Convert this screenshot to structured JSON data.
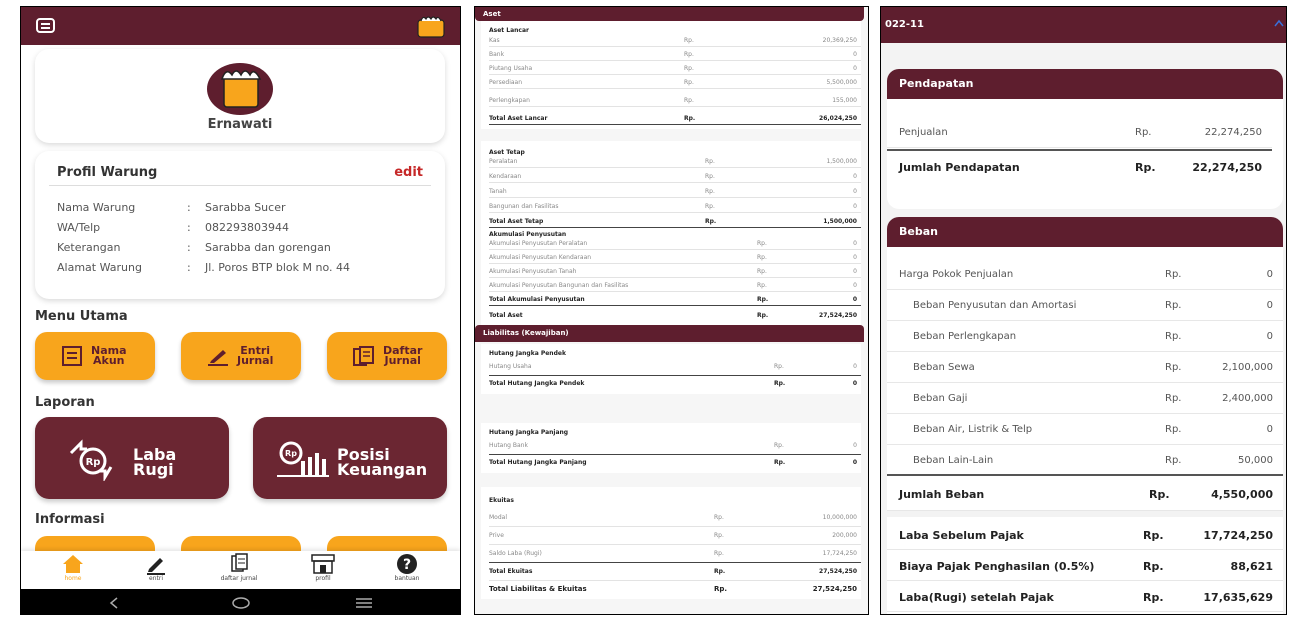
{
  "app": {
    "user_name": "Ernawati"
  },
  "profile": {
    "title": "Profil Warung",
    "edit_label": "edit",
    "rows": [
      {
        "key": "Nama Warung",
        "colon": ":",
        "value": "Sarabba Sucer"
      },
      {
        "key": "WA/Telp",
        "colon": ":",
        "value": "082293803944"
      },
      {
        "key": "Keterangan",
        "colon": ":",
        "value": "Sarabba dan gorengan"
      },
      {
        "key": "Alamat Warung",
        "colon": ":",
        "value": "Jl. Poros BTP blok M no. 44"
      }
    ]
  },
  "menu": {
    "title": "Menu Utama",
    "items": [
      {
        "label_1": "Nama",
        "label_2": "Akun"
      },
      {
        "label_1": "Entri",
        "label_2": "Jurnal"
      },
      {
        "label_1": "Daftar",
        "label_2": "Jurnal"
      }
    ]
  },
  "reports": {
    "title": "Laporan",
    "items": [
      {
        "label_1": "Laba",
        "label_2": "Rugi"
      },
      {
        "label_1": "Posisi",
        "label_2": "Keuangan"
      }
    ]
  },
  "info": {
    "title": "Informasi"
  },
  "bottom_nav": [
    {
      "label": "home"
    },
    {
      "label": "entri"
    },
    {
      "label": "daftar jurnal"
    },
    {
      "label": "profil"
    },
    {
      "label": "bantuan"
    }
  ],
  "neraca": {
    "aset_header": "Aset",
    "aset_lancar_title": "Aset Lancar",
    "aset_lancar": [
      {
        "label": "Kas",
        "rp": "Rp.",
        "value": "20,369,250"
      },
      {
        "label": "Bank",
        "rp": "Rp.",
        "value": "0"
      },
      {
        "label": "Piutang Usaha",
        "rp": "Rp.",
        "value": "0"
      },
      {
        "label": "Persediaan",
        "rp": "Rp.",
        "value": "5,500,000"
      },
      {
        "label": "Perlengkapan",
        "rp": "Rp.",
        "value": "155,000"
      }
    ],
    "total_aset_lancar": {
      "label": "Total Aset Lancar",
      "rp": "Rp.",
      "value": "26,024,250"
    },
    "aset_tetap_title": "Aset Tetap",
    "aset_tetap": [
      {
        "label": "Peralatan",
        "rp": "Rp.",
        "value": "1,500,000"
      },
      {
        "label": "Kendaraan",
        "rp": "Rp.",
        "value": "0"
      },
      {
        "label": "Tanah",
        "rp": "Rp.",
        "value": "0"
      },
      {
        "label": "Bangunan dan Fasilitas",
        "rp": "Rp.",
        "value": "0"
      }
    ],
    "total_aset_tetap": {
      "label": "Total Aset Tetap",
      "rp": "Rp.",
      "value": "1,500,000"
    },
    "akumulasi_title": "Akumulasi Penyusutan",
    "akumulasi": [
      {
        "label": "Akumulasi Penyusutan Peralatan",
        "rp": "Rp.",
        "value": "0"
      },
      {
        "label": "Akumulasi Penyusutan Kendaraan",
        "rp": "Rp.",
        "value": "0"
      },
      {
        "label": "Akumulasi Penyusutan Tanah",
        "rp": "Rp.",
        "value": "0"
      },
      {
        "label": "Akumulasi Penyusutan Bangunan dan Fasilitas",
        "rp": "Rp.",
        "value": "0"
      }
    ],
    "total_akumulasi": {
      "label": "Total Akumulasi Penyusutan",
      "rp": "Rp.",
      "value": "0"
    },
    "total_aset": {
      "label": "Total Aset",
      "rp": "Rp.",
      "value": "27,524,250"
    },
    "liabilitas_header": "Liabilitas (Kewajiban)",
    "hjp_title": "Hutang Jangka Pendek",
    "hjp": [
      {
        "label": "Hutang Usaha",
        "rp": "Rp.",
        "value": "0"
      }
    ],
    "total_hjp": {
      "label": "Total Hutang Jangka Pendek",
      "rp": "Rp.",
      "value": "0"
    },
    "hjpj_title": "Hutang Jangka Panjang",
    "hjpj": [
      {
        "label": "Hutang Bank",
        "rp": "Rp.",
        "value": "0"
      }
    ],
    "total_hjpj": {
      "label": "Total Hutang Jangka Panjang",
      "rp": "Rp.",
      "value": "0"
    },
    "ekuitas_title": "Ekuitas",
    "ekuitas": [
      {
        "label": "Modal",
        "rp": "Rp.",
        "value": "10,000,000"
      },
      {
        "label": "Prive",
        "rp": "Rp.",
        "value": "200,000"
      },
      {
        "label": "Saldo Laba (Rugi)",
        "rp": "Rp.",
        "value": "17,724,250"
      }
    ],
    "total_ekuitas": {
      "label": "Total Ekuitas",
      "rp": "Rp.",
      "value": "27,524,250"
    },
    "total_le": {
      "label": "Total Liabilitas & Ekuitas",
      "rp": "Rp.",
      "value": "27,524,250"
    }
  },
  "labarugi": {
    "period": "022-11",
    "pendapatan_header": "Pendapatan",
    "penjualan": {
      "label": "Penjualan",
      "rp": "Rp.",
      "value": "22,274,250"
    },
    "jumlah_pendapatan": {
      "label": "Jumlah Pendapatan",
      "rp": "Rp.",
      "value": "22,274,250"
    },
    "beban_header": "Beban",
    "beban": [
      {
        "label": "Harga Pokok Penjualan",
        "rp": "Rp.",
        "value": "0"
      },
      {
        "label": "Beban Penyusutan dan Amortasi",
        "rp": "Rp.",
        "value": "0"
      },
      {
        "label": "Beban Perlengkapan",
        "rp": "Rp.",
        "value": "0"
      },
      {
        "label": "Beban Sewa",
        "rp": "Rp.",
        "value": "2,100,000"
      },
      {
        "label": "Beban Gaji",
        "rp": "Rp.",
        "value": "2,400,000"
      },
      {
        "label": "Beban Air, Listrik & Telp",
        "rp": "Rp.",
        "value": "0"
      },
      {
        "label": "Beban Lain-Lain",
        "rp": "Rp.",
        "value": "50,000"
      }
    ],
    "jumlah_beban": {
      "label": "Jumlah Beban",
      "rp": "Rp.",
      "value": "4,550,000"
    },
    "summary": [
      {
        "label": "Laba Sebelum Pajak",
        "rp": "Rp.",
        "value": "17,724,250"
      },
      {
        "label": "Biaya Pajak Penghasilan (0.5%)",
        "rp": "Rp.",
        "value": "88,621"
      },
      {
        "label": "Laba(Rugi) setelah Pajak",
        "rp": "Rp.",
        "value": "17,635,629"
      }
    ]
  },
  "colors": {
    "maroon": "#5e1e2e",
    "orange": "#f8a51c"
  }
}
